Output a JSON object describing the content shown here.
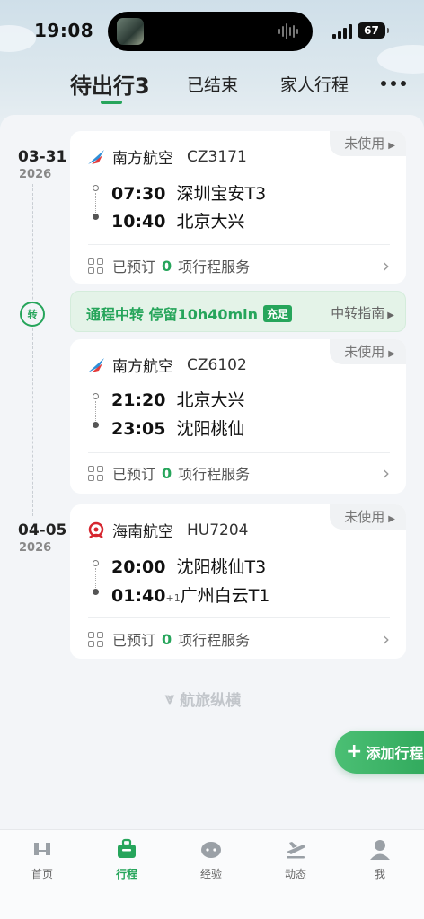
{
  "status_bar": {
    "time": "19:08",
    "battery": "67"
  },
  "tabs": [
    {
      "label": "待出行3"
    },
    {
      "label": "已结束"
    },
    {
      "label": "家人行程"
    }
  ],
  "trips": [
    {
      "date": "03-31",
      "year": "2026"
    },
    {
      "date": "04-05",
      "year": "2026"
    }
  ],
  "transfer_icon": "转",
  "flights": [
    {
      "status": "未使用",
      "airline": "南方航空",
      "flight_no": "CZ3171",
      "dep_time": "07:30",
      "dep_airport": "深圳宝安T3",
      "arr_time": "10:40",
      "arr_airport": "北京大兴",
      "arr_plus": "",
      "booked_label": "已预订",
      "booked_count": "0",
      "service_label": "项行程服务"
    },
    {
      "status": "未使用",
      "airline": "南方航空",
      "flight_no": "CZ6102",
      "dep_time": "21:20",
      "dep_airport": "北京大兴",
      "arr_time": "23:05",
      "arr_airport": "沈阳桃仙",
      "arr_plus": "",
      "booked_label": "已预订",
      "booked_count": "0",
      "service_label": "项行程服务"
    },
    {
      "status": "未使用",
      "airline": "海南航空",
      "flight_no": "HU7204",
      "dep_time": "20:00",
      "dep_airport": "沈阳桃仙T3",
      "arr_time": "01:40",
      "arr_airport": "广州白云T1",
      "arr_plus": "+1",
      "booked_label": "已预订",
      "booked_count": "0",
      "service_label": "项行程服务"
    }
  ],
  "transfer": {
    "text": "通程中转 停留10h40min",
    "badge": "充足",
    "guide": "中转指南"
  },
  "brand": "航旅纵横",
  "add_button": "添加行程",
  "bottom_nav": [
    {
      "label": "首页",
      "icon": "home-icon"
    },
    {
      "label": "行程",
      "icon": "trip-icon"
    },
    {
      "label": "经验",
      "icon": "experience-icon"
    },
    {
      "label": "动态",
      "icon": "flight-status-icon"
    },
    {
      "label": "我",
      "icon": "profile-icon"
    }
  ],
  "colors": {
    "accent": "#26a55b",
    "china_southern": "#2f8fd8",
    "hainan": "#d6262f"
  }
}
